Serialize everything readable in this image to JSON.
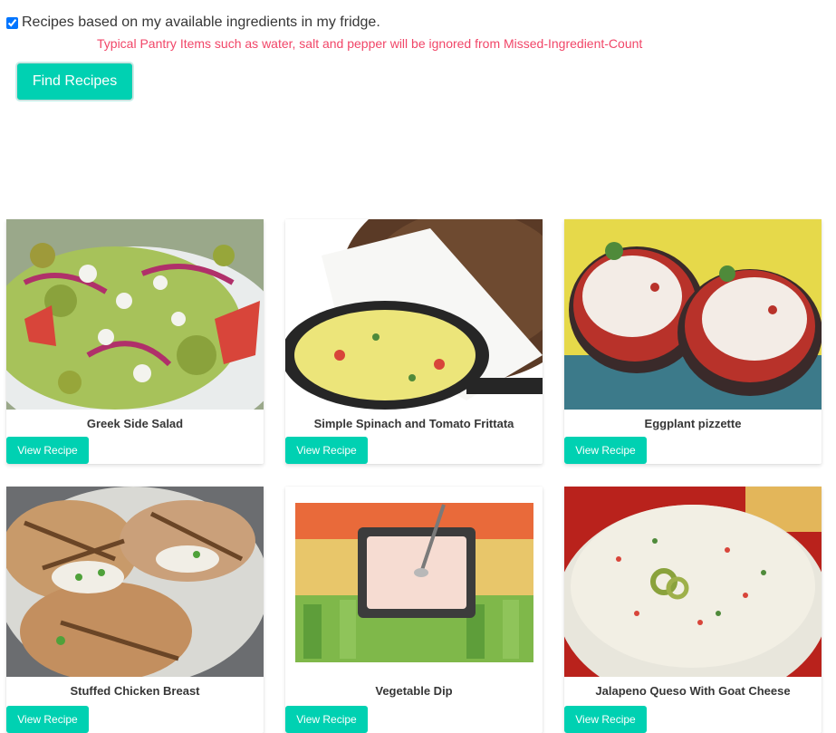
{
  "filter": {
    "checked": true,
    "label": "Recipes based on my available ingredients in my fridge.",
    "note": "Typical Pantry Items such as water, salt and pepper will be ignored from Missed-Ingredient-Count"
  },
  "find_button": "Find Recipes",
  "view_label": "View Recipe",
  "recipes": [
    {
      "title": "Greek Side Salad"
    },
    {
      "title": "Simple Spinach and Tomato Frittata"
    },
    {
      "title": "Eggplant pizzette"
    },
    {
      "title": "Stuffed Chicken Breast"
    },
    {
      "title": "Vegetable Dip"
    },
    {
      "title": "Jalapeno Queso With Goat Cheese"
    }
  ],
  "colors": {
    "primary": "#00d1b2",
    "danger": "#f14668",
    "text": "#363636"
  }
}
